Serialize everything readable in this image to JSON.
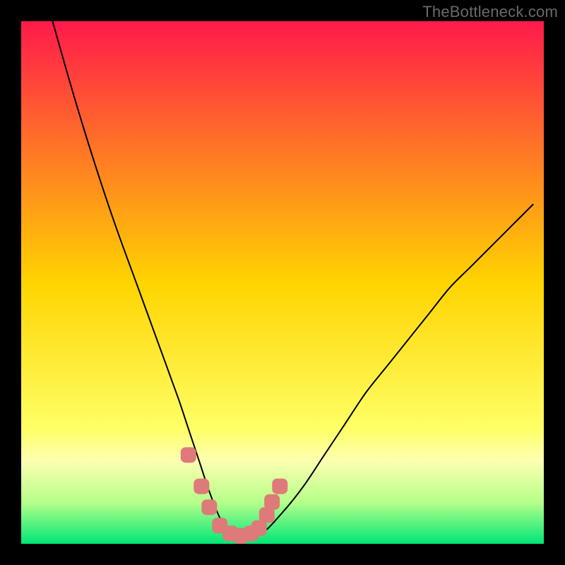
{
  "attribution": "TheBottleneck.com",
  "chart_data": {
    "type": "line",
    "title": "",
    "xlabel": "",
    "ylabel": "",
    "xlim": [
      0,
      100
    ],
    "ylim": [
      0,
      100
    ],
    "background_gradient": {
      "stops": [
        {
          "offset": 0.0,
          "color": "#ff1a4b"
        },
        {
          "offset": 0.5,
          "color": "#ffd400"
        },
        {
          "offset": 0.78,
          "color": "#ffff66"
        },
        {
          "offset": 0.84,
          "color": "#fdffb0"
        },
        {
          "offset": 0.92,
          "color": "#b6ff8a"
        },
        {
          "offset": 1.0,
          "color": "#00e676"
        }
      ]
    },
    "series": [
      {
        "name": "bottleneck-curve",
        "x": [
          6,
          10,
          14,
          18,
          22,
          26,
          30,
          32,
          34,
          36,
          38,
          40,
          42,
          46,
          50,
          54,
          58,
          62,
          66,
          70,
          74,
          78,
          82,
          86,
          90,
          94,
          98
        ],
        "values": [
          100,
          86,
          73,
          61,
          50,
          39,
          28,
          22,
          16,
          10,
          5,
          2,
          1,
          2,
          6,
          11,
          17,
          23,
          29,
          34,
          39,
          44,
          49,
          53,
          57,
          61,
          65
        ]
      }
    ],
    "highlight_points": {
      "name": "optimal-range-markers",
      "color": "#de7a7a",
      "x": [
        32.0,
        34.5,
        36.0,
        38.0,
        40.0,
        42.0,
        44.0,
        45.5,
        47.0,
        48.0,
        49.5
      ],
      "values": [
        17.0,
        11.0,
        7.0,
        3.5,
        2.0,
        1.5,
        2.0,
        3.0,
        5.5,
        8.0,
        11.0
      ]
    }
  }
}
